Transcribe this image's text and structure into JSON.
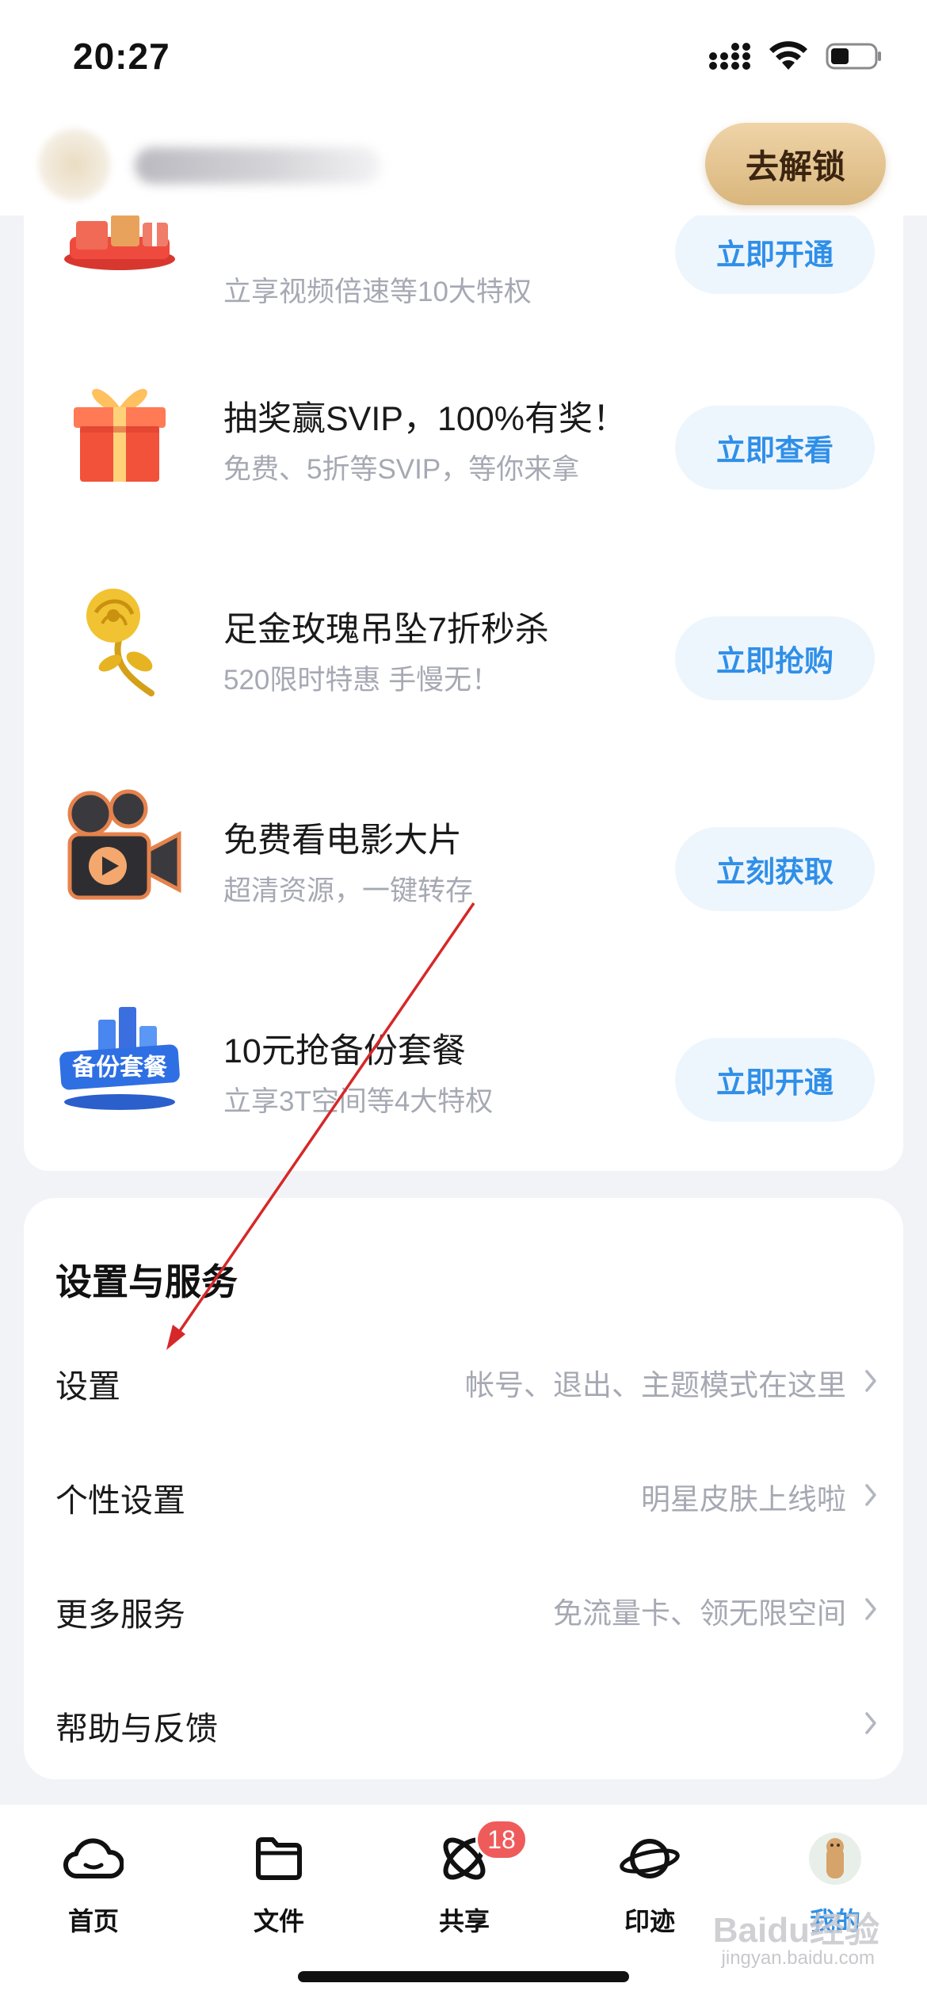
{
  "status_bar": {
    "time": "20:27"
  },
  "header": {
    "unlock_label": "去解锁"
  },
  "promos": [
    {
      "title": "",
      "subtitle": "立享视频倍速等10大特权",
      "button": "立即开通",
      "icon": "svip-gift-boxes-icon"
    },
    {
      "title": "抽奖赢SVIP，100%有奖！",
      "subtitle": "免费、5折等SVIP，等你来拿",
      "button": "立即查看",
      "icon": "gift-box-icon"
    },
    {
      "title": "足金玫瑰吊坠7折秒杀",
      "subtitle": "520限时特惠 手慢无！",
      "button": "立即抢购",
      "icon": "gold-rose-icon"
    },
    {
      "title": "免费看电影大片",
      "subtitle": "超清资源，一键转存",
      "button": "立刻获取",
      "icon": "movie-camera-icon"
    },
    {
      "title": "10元抢备份套餐",
      "subtitle": "立享3T空间等4大特权",
      "button": "立即开通",
      "icon": "backup-package-icon",
      "icon_text": "备份套餐"
    }
  ],
  "settings": {
    "title": "设置与服务",
    "rows": [
      {
        "label": "设置",
        "desc": "帐号、退出、主题模式在这里"
      },
      {
        "label": "个性设置",
        "desc": "明星皮肤上线啦"
      },
      {
        "label": "更多服务",
        "desc": "免流量卡、领无限空间"
      },
      {
        "label": "帮助与反馈",
        "desc": ""
      }
    ]
  },
  "tabs": [
    {
      "label": "首页",
      "icon": "cloud-icon"
    },
    {
      "label": "文件",
      "icon": "folder-icon"
    },
    {
      "label": "共享",
      "icon": "share-orbit-icon",
      "badge": "18"
    },
    {
      "label": "印迹",
      "icon": "planet-icon"
    },
    {
      "label": "我的",
      "icon": "profile-avatar-icon",
      "active": true
    }
  ],
  "watermark": {
    "brand": "Baidu经验",
    "site": "jingyan.baidu.com"
  },
  "colors": {
    "accent": "#2f8fe8",
    "badge": "#ef5b5b",
    "unlock_gold": "#d9b67c",
    "annotation_arrow": "#d62828"
  }
}
